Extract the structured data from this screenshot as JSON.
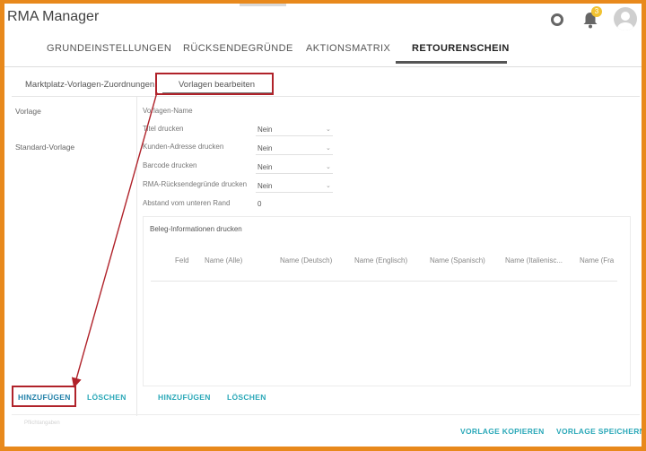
{
  "app": {
    "title": "RMA Manager",
    "notification_count": "3"
  },
  "topbar": {
    "icons": [
      "help-icon",
      "bell-icon",
      "avatar"
    ]
  },
  "nav": {
    "tabs": [
      {
        "label": "GRUNDEINSTELLUNGEN",
        "active": false
      },
      {
        "label": "RÜCKSENDEGRÜNDE",
        "active": false
      },
      {
        "label": "AKTIONSMATRIX",
        "active": false
      },
      {
        "label": "RETOURENSCHEIN",
        "active": true
      }
    ]
  },
  "subtabs": [
    {
      "label": "Marktplatz-Vorlagen-Zuordnungen",
      "active": false
    },
    {
      "label": "Vorlagen bearbeiten",
      "active": true
    }
  ],
  "left": {
    "header": "Vorlage",
    "items": [
      "Standard-Vorlage"
    ],
    "add_label": "HINZUFÜGEN",
    "delete_label": "LÖSCHEN"
  },
  "form": {
    "name_label": "Vorlagen-Name",
    "fields": [
      {
        "label": "Titel drucken",
        "value": "Nein"
      },
      {
        "label": "Kunden-Adresse drucken",
        "value": "Nein"
      },
      {
        "label": "Barcode drucken",
        "value": "Nein"
      },
      {
        "label": "RMA-Rücksendegründe drucken",
        "value": "Nein"
      }
    ],
    "margin_label": "Abstand vom unteren Rand",
    "margin_value": "0"
  },
  "beleg": {
    "title": "Beleg-Informationen drucken",
    "columns": [
      "Feld",
      "Name (Alle)",
      "Name (Deutsch)",
      "Name (Englisch)",
      "Name (Spanisch)",
      "Name (Italienisc...",
      "Name (Fra"
    ],
    "add_label": "HINZUFÜGEN",
    "delete_label": "LÖSCHEN"
  },
  "footer": {
    "faint_text": "Pflichtangaben",
    "copy_label": "VORLAGE KOPIEREN",
    "save_label": "VORLAGE SPEICHERN"
  },
  "colors": {
    "frame": "#e8891c",
    "highlight": "#b0222a",
    "accent": "#2aa8b8"
  }
}
